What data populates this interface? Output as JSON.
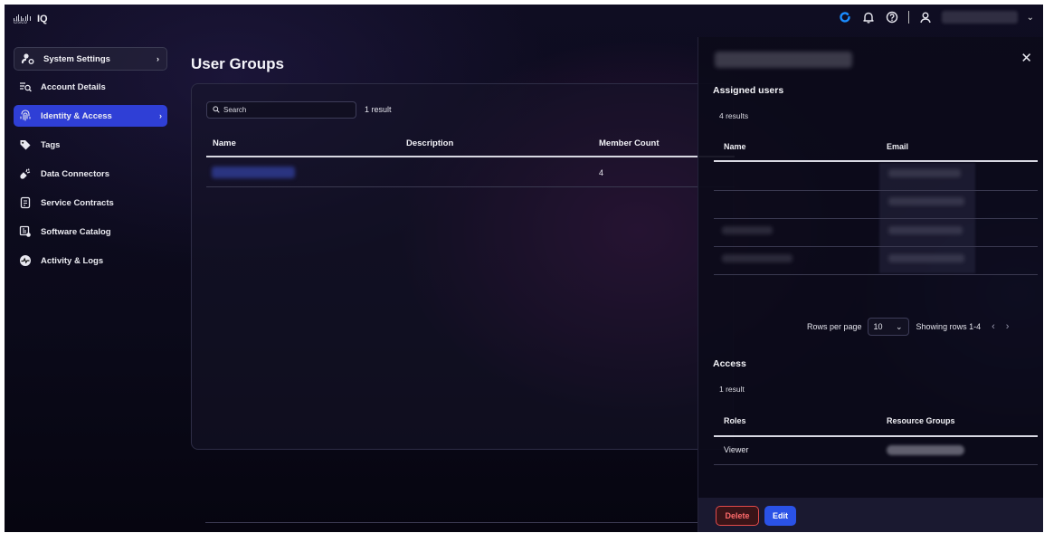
{
  "app": {
    "logo_text": "cisco",
    "name": "IQ"
  },
  "topbar": {
    "icons": [
      "refresh-icon",
      "bell-icon",
      "help-icon",
      "user-icon",
      "chevron-down-icon"
    ],
    "accent": "#1a8cff"
  },
  "sidebar": {
    "header": "System Settings",
    "items": [
      {
        "label": "Account Details",
        "icon": "account-details-icon",
        "active": false
      },
      {
        "label": "Identity & Access",
        "icon": "fingerprint-icon",
        "active": true
      },
      {
        "label": "Tags",
        "icon": "tag-icon",
        "active": false
      },
      {
        "label": "Data Connectors",
        "icon": "plug-icon",
        "active": false
      },
      {
        "label": "Service Contracts",
        "icon": "contract-icon",
        "active": false
      },
      {
        "label": "Software Catalog",
        "icon": "catalog-icon",
        "active": false
      },
      {
        "label": "Activity & Logs",
        "icon": "activity-icon",
        "active": false
      }
    ],
    "active_color": "#2f3fd6"
  },
  "main": {
    "title": "User Groups",
    "search_placeholder": "Search",
    "result_count": "1 result",
    "columns": [
      "Name",
      "Description",
      "Member Count"
    ],
    "rows": [
      {
        "member_count": "4"
      }
    ]
  },
  "drawer": {
    "assigned_users": {
      "title": "Assigned users",
      "count": "4 results",
      "columns": [
        "Name",
        "Email"
      ]
    },
    "pagination": {
      "rows_per_page_label": "Rows per page",
      "rows_per_page_value": "10",
      "showing": "Showing rows 1-4"
    },
    "access": {
      "title": "Access",
      "count": "1 result",
      "columns": [
        "Roles",
        "Resource Groups"
      ],
      "rows": [
        {
          "role": "Viewer"
        }
      ]
    },
    "buttons": {
      "delete": "Delete",
      "edit": "Edit"
    },
    "colors": {
      "delete": "#e24a4a",
      "edit": "#2a52e6"
    }
  }
}
